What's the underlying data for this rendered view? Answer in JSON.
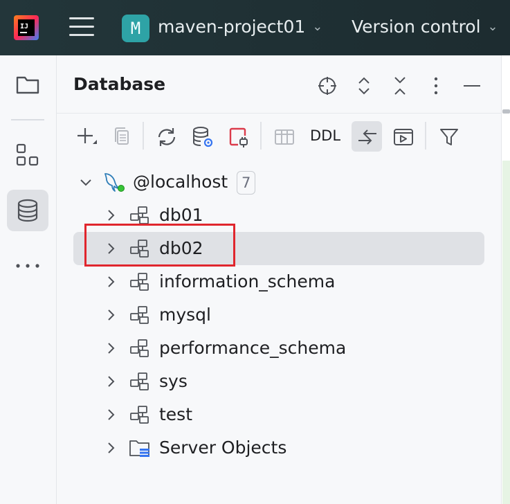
{
  "titlebar": {
    "logo_text": "IJ",
    "project_badge": "M",
    "project_name": "maven-project01",
    "vcs_label": "Version control",
    "colors": {
      "background": "#21343a",
      "badge": "#2ea3a6"
    }
  },
  "toolstrip": {
    "items": [
      {
        "name": "project-folder-icon",
        "active": false
      },
      {
        "name": "structure-icon",
        "active": false
      },
      {
        "name": "database-icon",
        "active": true
      },
      {
        "name": "more-icon",
        "active": false
      }
    ]
  },
  "panel": {
    "title": "Database",
    "header_icons": [
      "locate-icon",
      "expand-all-icon",
      "collapse-all-icon",
      "more-vertical-icon",
      "minimize-icon"
    ],
    "toolbar": {
      "ddl_label": "DDL",
      "items": [
        "add-icon",
        "copy-icon",
        "refresh-icon",
        "data-source-properties-icon",
        "disconnect-icon",
        "table-editor-icon",
        "ddl-button",
        "compare-icon",
        "console-icon",
        "filter-icon"
      ]
    },
    "tree": {
      "root": {
        "label": "@localhost",
        "count": "7",
        "expanded": true,
        "connected": true
      },
      "children": [
        {
          "label": "db01",
          "type": "schema",
          "selected": false
        },
        {
          "label": "db02",
          "type": "schema",
          "selected": true
        },
        {
          "label": "information_schema",
          "type": "schema",
          "selected": false
        },
        {
          "label": "mysql",
          "type": "schema",
          "selected": false
        },
        {
          "label": "performance_schema",
          "type": "schema",
          "selected": false
        },
        {
          "label": "sys",
          "type": "schema",
          "selected": false
        },
        {
          "label": "test",
          "type": "schema",
          "selected": false
        },
        {
          "label": "Server Objects",
          "type": "folder",
          "selected": false
        }
      ]
    },
    "highlight_color": "#e0262d"
  }
}
